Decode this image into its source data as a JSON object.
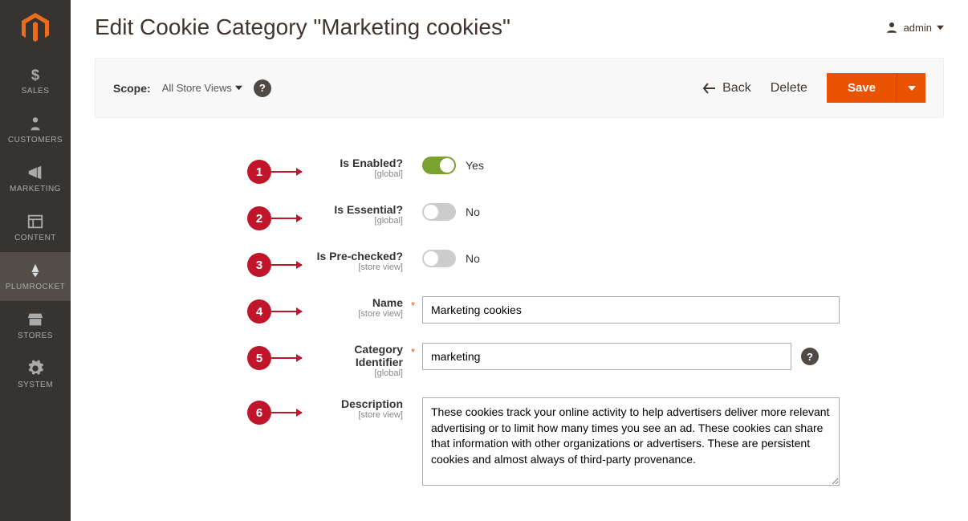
{
  "sidebar": {
    "items": [
      {
        "icon": "dollar",
        "label": "SALES"
      },
      {
        "icon": "person",
        "label": "CUSTOMERS"
      },
      {
        "icon": "megaphone",
        "label": "MARKETING"
      },
      {
        "icon": "layout",
        "label": "CONTENT"
      },
      {
        "icon": "plumrocket",
        "label": "PLUMROCKET"
      },
      {
        "icon": "storefront",
        "label": "STORES"
      },
      {
        "icon": "gear",
        "label": "SYSTEM"
      }
    ]
  },
  "header": {
    "title": "Edit Cookie Category \"Marketing cookies\"",
    "user": "admin"
  },
  "toolbar": {
    "scope_label": "Scope:",
    "scope_value": "All Store Views",
    "back_label": "Back",
    "delete_label": "Delete",
    "save_label": "Save"
  },
  "form": {
    "is_enabled": {
      "badge": "1",
      "label": "Is Enabled?",
      "scope": "[global]",
      "on": true,
      "value": "Yes",
      "required": false
    },
    "is_essential": {
      "badge": "2",
      "label": "Is Essential?",
      "scope": "[global]",
      "on": false,
      "value": "No",
      "required": false
    },
    "is_prechecked": {
      "badge": "3",
      "label": "Is Pre-checked?",
      "scope": "[store view]",
      "on": false,
      "value": "No",
      "required": false
    },
    "name": {
      "badge": "4",
      "label": "Name",
      "scope": "[store view]",
      "value": "Marketing cookies",
      "required": true
    },
    "identifier": {
      "badge": "5",
      "label": "Category Identifier",
      "scope": "[global]",
      "value": "marketing",
      "required": true,
      "help": true
    },
    "description": {
      "badge": "6",
      "label": "Description",
      "scope": "[store view]",
      "value": "These cookies track your online activity to help advertisers deliver more relevant advertising or to limit how many times you see an ad. These cookies can share that information with other organizations or advertisers. These are persistent cookies and almost always of third-party provenance.",
      "required": false
    }
  },
  "colors": {
    "accent": "#eb5202",
    "badge": "#c1152b",
    "toggle_on": "#79a22e"
  }
}
